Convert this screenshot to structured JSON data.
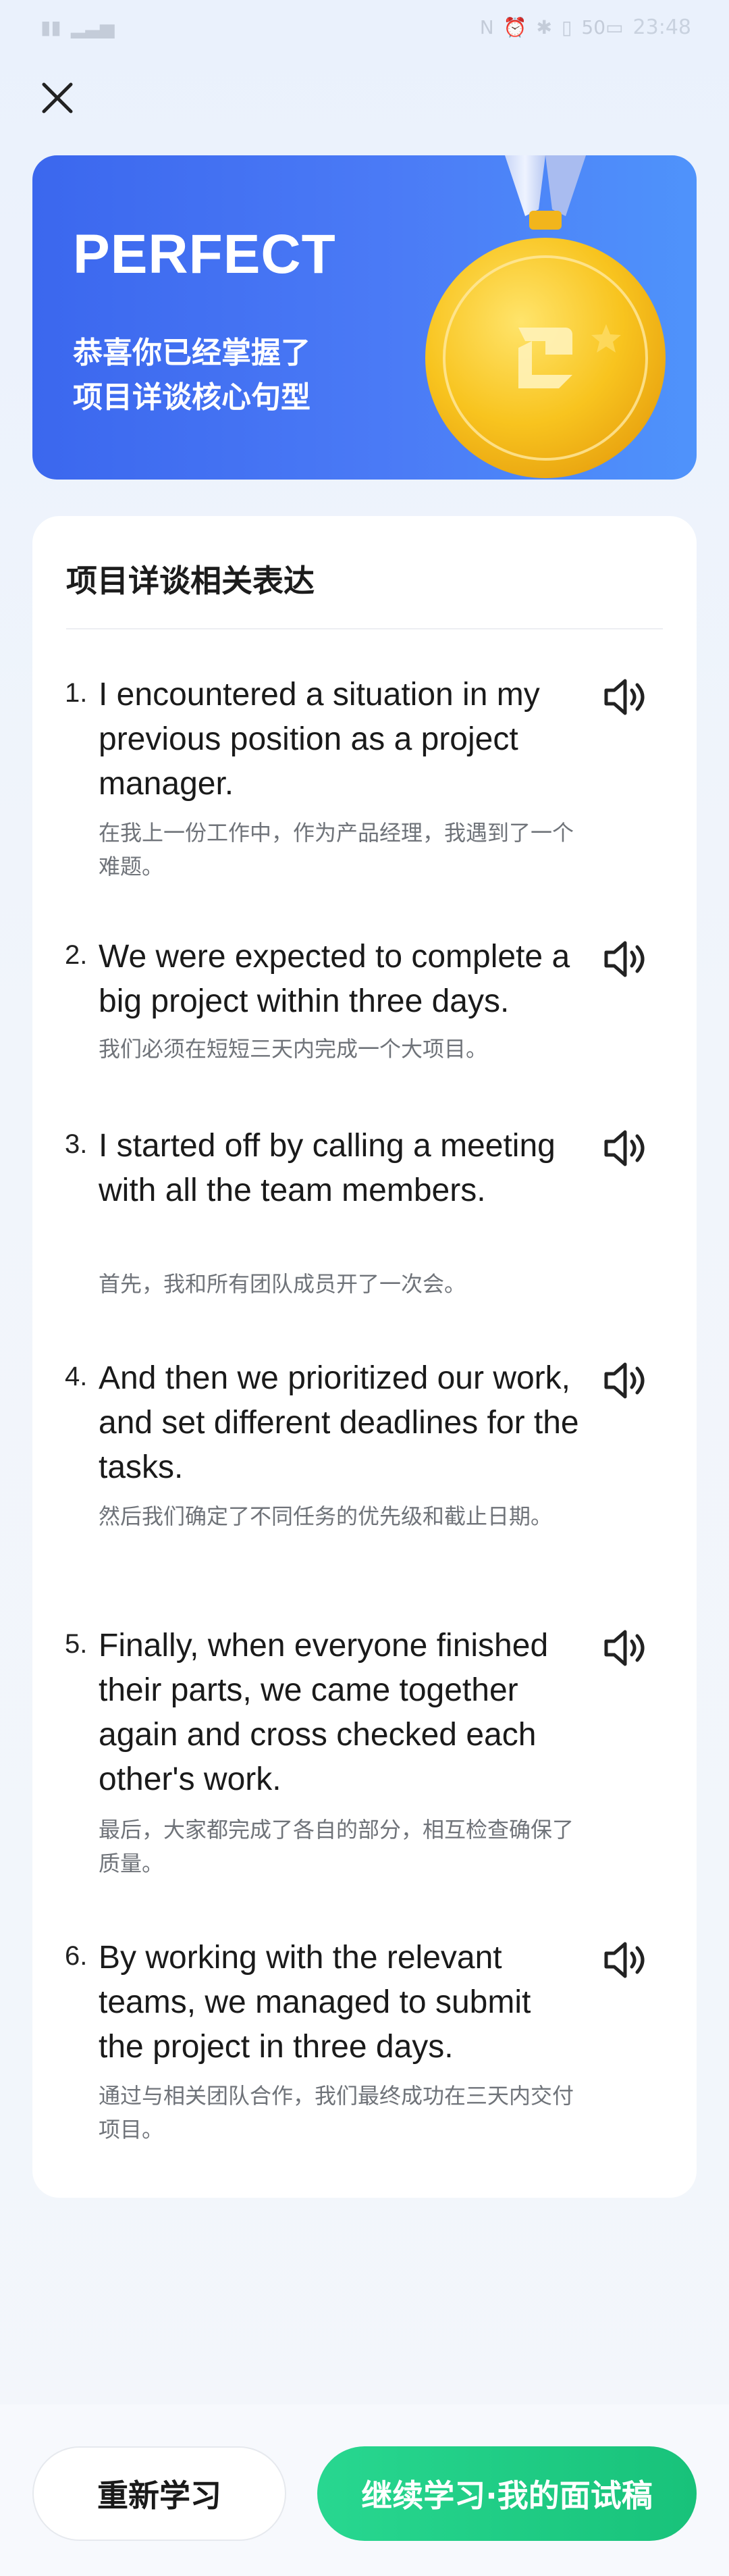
{
  "status_bar": {
    "time": "23:48",
    "battery": "50"
  },
  "hero": {
    "title": "PERFECT",
    "subtitle_line1": "恭喜你已经掌握了",
    "subtitle_line2": "项目详谈核心句型"
  },
  "card": {
    "title": "项目详谈相关表达",
    "items": [
      {
        "num": "1.",
        "en": "I encountered a situation in my previous position as a project manager.",
        "zh": "在我上一份工作中，作为产品经理，我遇到了一个难题。"
      },
      {
        "num": "2.",
        "en": "We were expected to complete a big project within three days.",
        "zh": "我们必须在短短三天内完成一个大项目。"
      },
      {
        "num": "3.",
        "en": "I started off by calling a meeting with all the team members.",
        "zh": "首先，我和所有团队成员开了一次会。"
      },
      {
        "num": "4.",
        "en": "And then we prioritized our work, and set different deadlines for the tasks.",
        "zh": "然后我们确定了不同任务的优先级和截止日期。"
      },
      {
        "num": "5.",
        "en": "Finally, when everyone finished their parts, we came together again and cross checked each other's work.",
        "zh": "最后，大家都完成了各自的部分，相互检查确保了质量。"
      },
      {
        "num": "6.",
        "en": "By working with the relevant teams, we managed to submit the project in three days.",
        "zh": "通过与相关团队合作，我们最终成功在三天内交付项目。"
      }
    ]
  },
  "buttons": {
    "relearn": "重新学习",
    "continue": "继续学习·我的面试稿"
  },
  "icons": {
    "close": "close-icon",
    "speaker": "speaker-icon",
    "medal": "medal-icon"
  },
  "colors": {
    "hero_start": "#3b67ee",
    "hero_end": "#4f93fb",
    "accent_green": "#1fcb82",
    "medal_gold": "#f7c21e"
  }
}
